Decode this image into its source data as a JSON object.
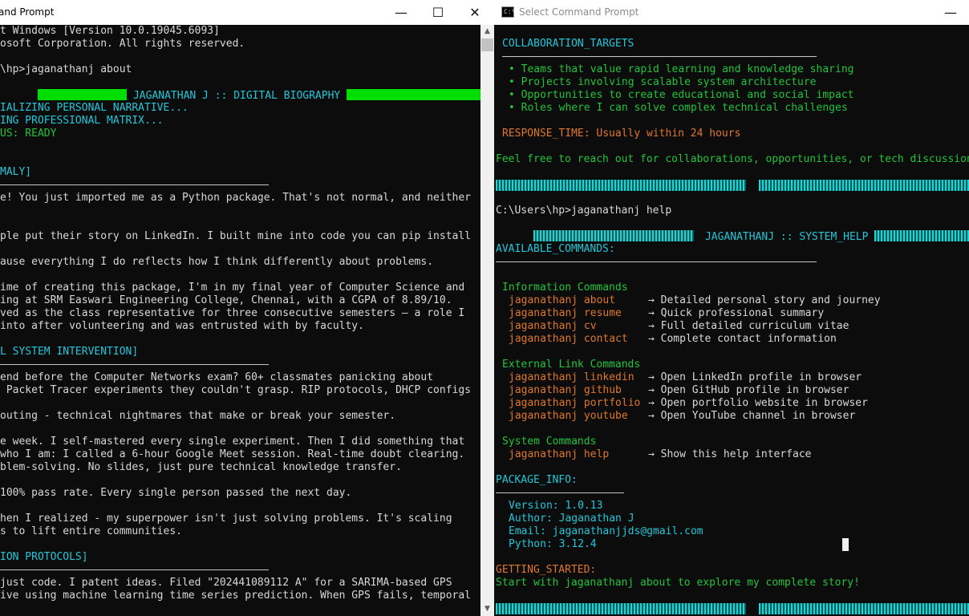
{
  "left_window": {
    "title": "and Prompt",
    "lines": [
      "t Windows [Version 10.0.19045.6093]",
      "osoft Corporation. All rights reserved.",
      "\\hp>jaganathanj about",
      "JAGANATHAN J :: DIGITAL BIOGRAPHY",
      "IALIZING PERSONAL NARRATIVE...",
      "ING PROFESSIONAL MATRIX...",
      "US: READY",
      "MALY]",
      "e! You just imported me as a Python package. That's not normal, and neither",
      "ple put their story on LinkedIn. I built mine into code you can pip install",
      "ause everything I do reflects how I think differently about problems.",
      "ime of creating this package, I'm in my final year of Computer Science and",
      "ing at SRM Easwari Engineering College, Chennai, with a CGPA of 8.89/10.",
      "ved as the class representative for three consecutive semesters — a role I",
      "into after volunteering and was entrusted with by faculty.",
      "L SYSTEM INTERVENTION]",
      "end before the Computer Networks exam? 60+ classmates panicking about",
      " Packet Tracer experiments they couldn't grasp. RIP protocols, DHCP configs",
      "outing - technical nightmares that make or break your semester.",
      "e week. I self-mastered every single experiment. Then I did something that",
      "who I am: I called a 6-hour Google Meet session. Real-time doubt clearing.",
      "blem-solving. No slides, just pure technical knowledge transfer.",
      "100% pass rate. Every single person passed the next day.",
      "hen I realized - my superpower isn't just solving problems. It's scaling",
      "s to lift entire communities.",
      "ION PROTOCOLS]",
      "just code. I patent ideas. Filed \"202441089112 A\" for a SARIMA-based GPS",
      "ive using machine learning time series prediction. When GPS fails, temporal"
    ]
  },
  "right_window": {
    "title": "Select Command Prompt",
    "icon_label": "C:\\",
    "collab_header": "COLLABORATION_TARGETS",
    "collab_items": [
      "• Teams that value rapid learning and knowledge sharing",
      "• Projects involving scalable system architecture",
      "• Opportunities to create educational and social impact",
      "• Roles where I can solve complex technical challenges"
    ],
    "response_time": "RESPONSE_TIME: Usually within 24 hours",
    "reach_out": "Feel free to reach out for collaborations, opportunities, or tech discussions",
    "prompt_help": "C:\\Users\\hp>jaganathanj help",
    "help_title": "JAGANATHANJ :: SYSTEM_HELP",
    "available_header": "AVAILABLE_COMMANDS:",
    "groups": [
      {
        "title": "Information Commands",
        "commands": [
          {
            "cmd": "jaganathanj about",
            "desc": "→ Detailed personal story and journey"
          },
          {
            "cmd": "jaganathanj resume",
            "desc": "→ Quick professional summary"
          },
          {
            "cmd": "jaganathanj cv",
            "desc": "→ Full detailed curriculum vitae"
          },
          {
            "cmd": "jaganathanj contact",
            "desc": "→ Complete contact information"
          }
        ]
      },
      {
        "title": "External Link Commands",
        "commands": [
          {
            "cmd": "jaganathanj linkedin",
            "desc": "→ Open LinkedIn profile in browser"
          },
          {
            "cmd": "jaganathanj github",
            "desc": "→ Open GitHub profile in browser"
          },
          {
            "cmd": "jaganathanj portfolio",
            "desc": "→ Open portfolio website in browser"
          },
          {
            "cmd": "jaganathanj youtube",
            "desc": "→ Open YouTube channel in browser"
          }
        ]
      },
      {
        "title": "System Commands",
        "commands": [
          {
            "cmd": "jaganathanj help",
            "desc": "→ Show this help interface"
          }
        ]
      }
    ],
    "package_header": "PACKAGE_INFO:",
    "package_info": {
      "version": "Version: 1.0.13",
      "author": "Author: Jaganathan J",
      "email": "Email: jaganathanjjds@gmail.com",
      "python": "Python: 3.12.4"
    },
    "getting_started_header": "GETTING_STARTED:",
    "getting_started_text": "Start with jaganathanj about to explore my complete story!"
  },
  "controls": {
    "minimize": "—",
    "maximize": "☐",
    "close": "✕"
  },
  "colors": {
    "background": "#0c0c0c",
    "cyan": "#22c7d9",
    "green": "#22c43a",
    "orange": "#e0772a",
    "white_text": "#d8d8d8",
    "bright_green_bar": "#00dd00"
  }
}
